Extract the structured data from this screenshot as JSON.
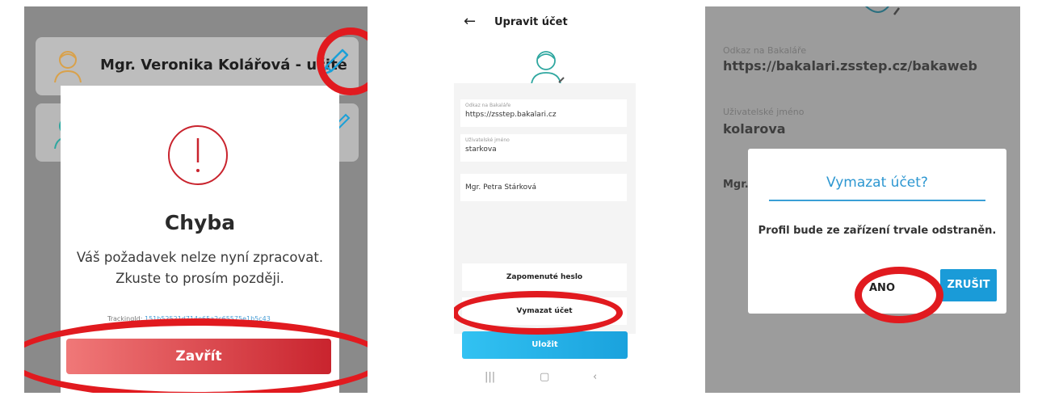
{
  "panel1": {
    "card1_name": "Mgr. Veronika Kolářová - učite",
    "error_title": "Chyba",
    "error_message": "Váš požadavek nelze nyní zpracovat. Zkuste to prosím později.",
    "tracking_label": "TrackingId:",
    "tracking_id": "151b52521d714e65a2c65575e1b5c43",
    "close_button": "Zavřít"
  },
  "panel2": {
    "back_arrow": "←",
    "title": "Upravit účet",
    "link_label": "Odkaz na Bakaláře",
    "link_value": "https://zsstep.bakalari.cz",
    "username_label": "Uživatelské jméno",
    "username_value": "starkova",
    "display_name": "Mgr. Petra Stárková",
    "forgot_password": "Zapomenuté heslo",
    "delete_account": "Vymazat účet",
    "save": "Uložit",
    "nav_recent": "|||",
    "nav_home": "▢",
    "nav_back": "‹"
  },
  "panel3": {
    "link_label": "Odkaz na Bakaláře",
    "link_value": "https://bakalari.zsstep.cz/bakaweb",
    "username_label": "Uživatelské jméno",
    "username_value": "kolarova",
    "name_partial": "Mgr.",
    "dialog_title": "Vymazat účet?",
    "dialog_message": "Profil bude ze zařízení trvale odstraněn.",
    "yes_button": "ANO",
    "cancel_button": "ZRUŠIT"
  },
  "colors": {
    "highlight_circle": "#e11a1f",
    "error_red": "#c9242e",
    "accent_blue": "#1a9bd8",
    "avatar_orange": "#d9a14a",
    "avatar_teal": "#2fa7a0"
  },
  "icons": [
    "user-avatar-icon",
    "edit-pencil-icon",
    "error-exclamation-icon",
    "back-arrow-icon",
    "nav-recent-icon",
    "nav-home-icon",
    "nav-back-icon"
  ]
}
